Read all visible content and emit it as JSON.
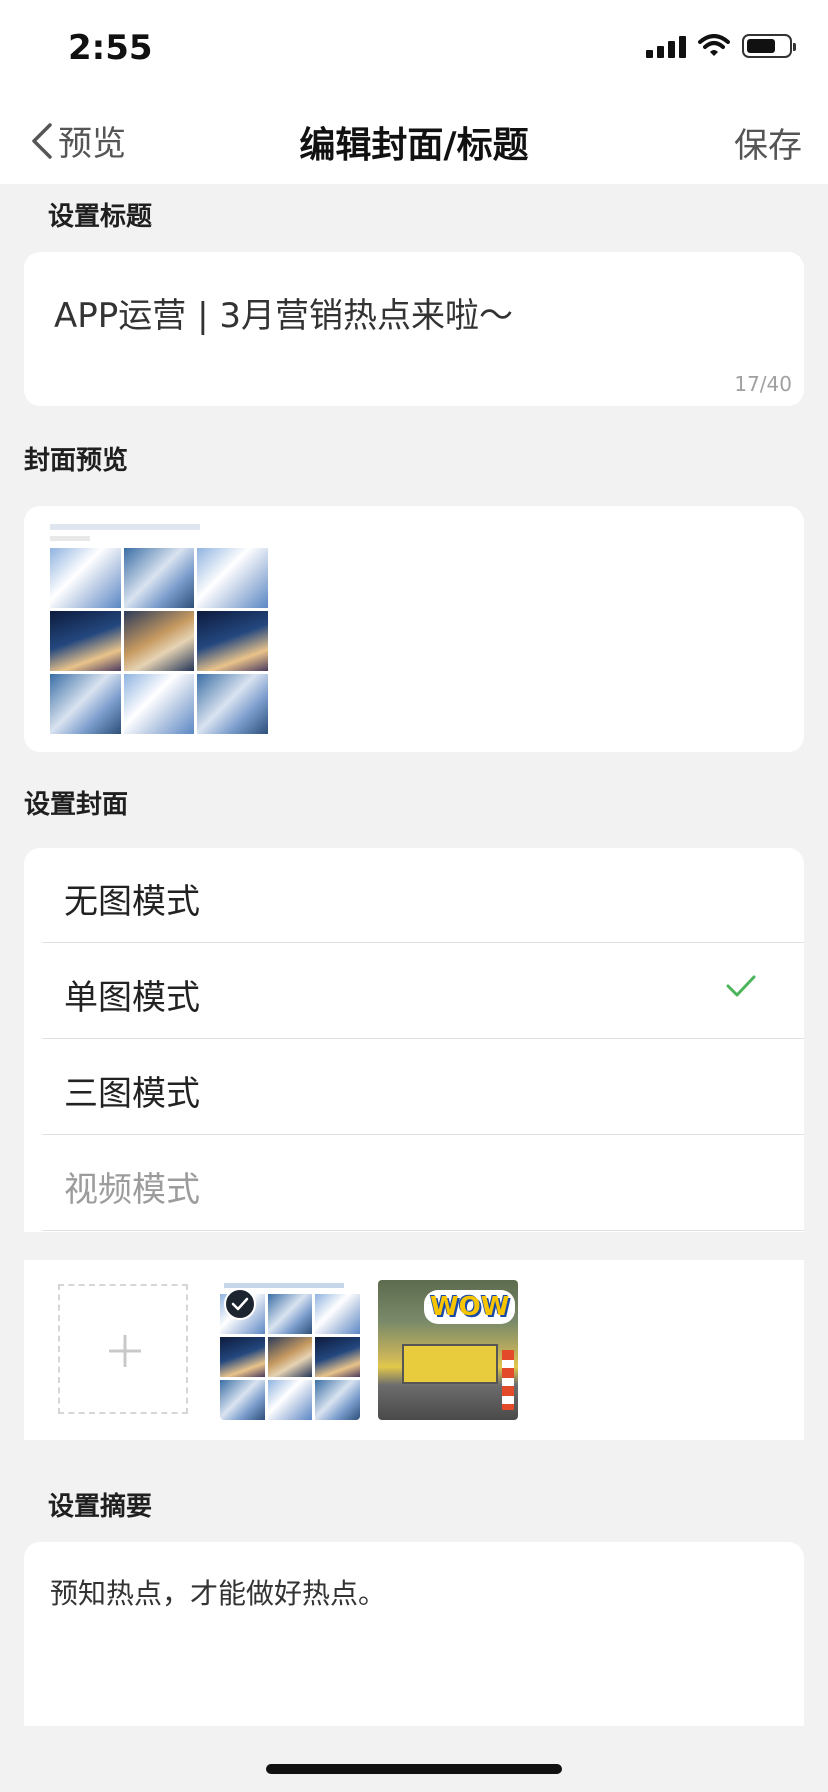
{
  "status_bar": {
    "time": "2:55",
    "icons": [
      "signal-icon",
      "wifi-icon",
      "battery-icon"
    ]
  },
  "nav": {
    "back_label": "预览",
    "title": "编辑封面/标题",
    "save_label": "保存"
  },
  "title_section": {
    "label": "设置标题",
    "value": "APP运营 | 3月营销热点来啦～",
    "count": "17/40"
  },
  "preview_section": {
    "label": "封面预览"
  },
  "cover_section": {
    "label": "设置封面",
    "modes": [
      {
        "label": "无图模式",
        "selected": false,
        "enabled": true
      },
      {
        "label": "单图模式",
        "selected": true,
        "enabled": true
      },
      {
        "label": "三图模式",
        "selected": false,
        "enabled": true
      },
      {
        "label": "视频模式",
        "selected": false,
        "enabled": false
      }
    ],
    "images": [
      {
        "name": "blossom-collage",
        "selected": true
      },
      {
        "name": "wow-street-photo",
        "selected": false
      }
    ],
    "photo_text": "WOW"
  },
  "summary_section": {
    "label": "设置摘要",
    "value": "预知热点，才能做好热点。"
  },
  "colors": {
    "background": "#f2f2f2",
    "card": "#ffffff",
    "check_green": "#4cb45a",
    "disabled_text": "#9c9c9c"
  }
}
